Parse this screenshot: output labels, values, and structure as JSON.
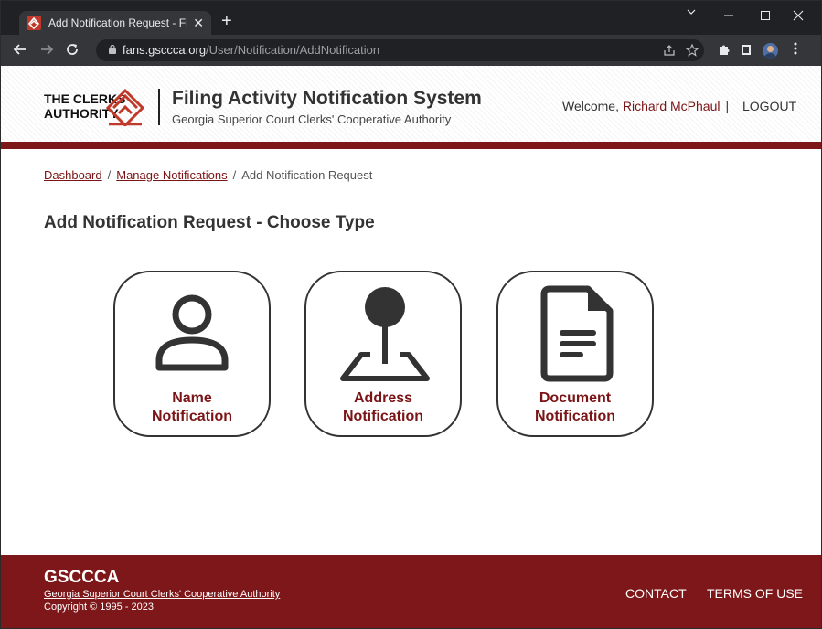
{
  "browser": {
    "tab_title": "Add Notification Request - Filing",
    "tab_close": "✕",
    "new_tab": "+",
    "url_host": "fans.gsccca.org",
    "url_path": "/User/Notification/AddNotification",
    "icons": {
      "favicon": "gsccca-logo-icon",
      "back": "arrow-left-icon",
      "forward": "arrow-right-icon",
      "reload": "reload-icon",
      "lock": "lock-icon",
      "share": "share-icon",
      "bookmark": "star-icon",
      "extensions": "puzzle-icon",
      "side_panel": "side-panel-icon",
      "profile": "avatar-icon",
      "menu": "kebab-menu-icon"
    }
  },
  "header": {
    "logo_line1": "THE CLERKS",
    "logo_line2": "AUTHORITY",
    "system_title": "Filing Activity Notification System",
    "system_subtitle": "Georgia Superior Court Clerks' Cooperative Authority",
    "welcome_prefix": "Welcome, ",
    "user_name": "Richard McPhaul",
    "separator": "|",
    "logout": "LOGOUT"
  },
  "breadcrumb": {
    "items": [
      "Dashboard",
      "Manage Notifications",
      "Add Notification Request"
    ],
    "separator": "/"
  },
  "page": {
    "title": "Add Notification Request - Choose Type"
  },
  "cards": [
    {
      "line1": "Name",
      "line2": "Notification",
      "icon": "person-icon"
    },
    {
      "line1": "Address",
      "line2": "Notification",
      "icon": "map-pin-icon"
    },
    {
      "line1": "Document",
      "line2": "Notification",
      "icon": "document-icon"
    }
  ],
  "footer": {
    "brand": "GSCCCA",
    "org": "Georgia Superior Court Clerks' Cooperative Authority",
    "copyright": "Copyright © 1995 - 2023",
    "contact": "CONTACT",
    "terms": "TERMS OF USE"
  },
  "colors": {
    "brand_maroon": "#7e1719",
    "link_maroon": "#7a1416",
    "chrome_dark": "#202124",
    "chrome_toolbar": "#35363a"
  }
}
